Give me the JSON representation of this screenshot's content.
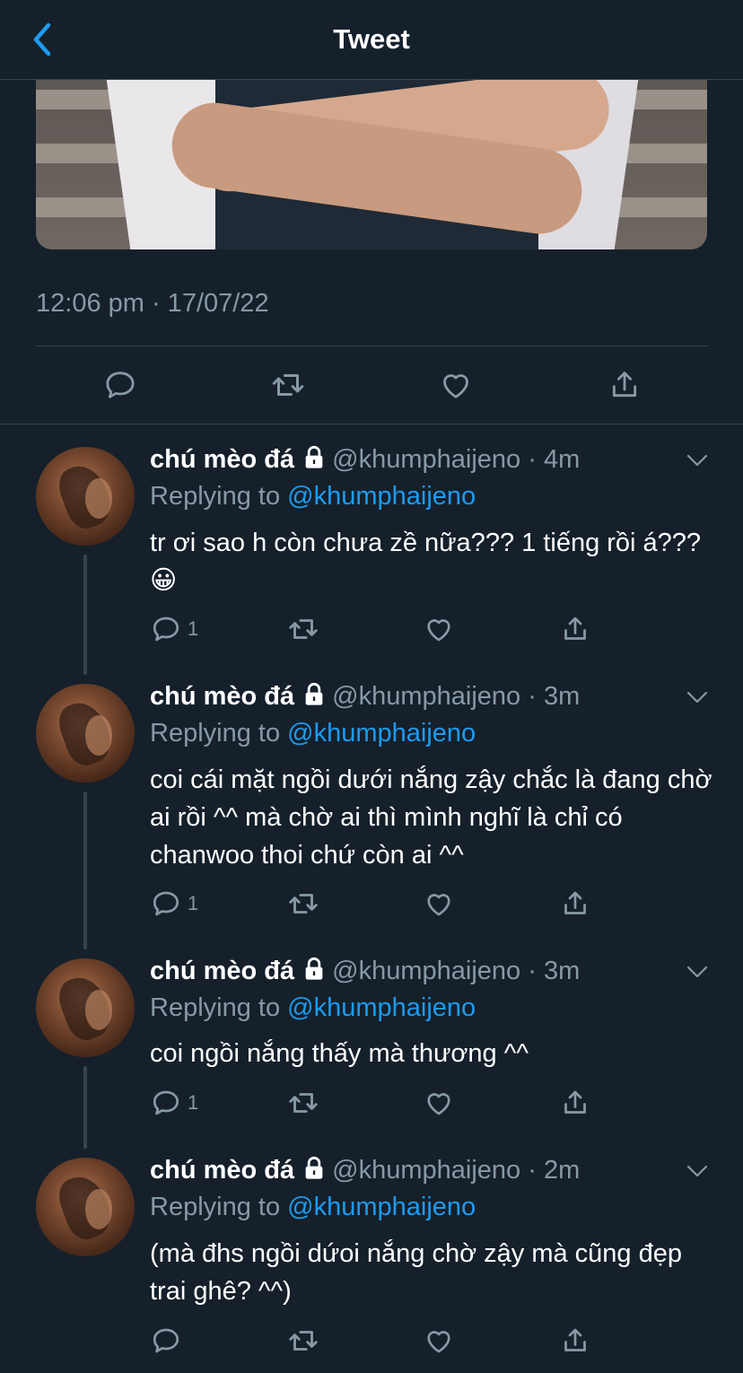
{
  "header": {
    "title": "Tweet"
  },
  "tweet": {
    "timestamp": "12:06 pm · 17/07/22"
  },
  "replies": [
    {
      "name": "chú mèo đá",
      "handle": "@khumphaijeno",
      "time": "4m",
      "replying_prefix": "Replying to",
      "replying_to": "@khumphaijeno",
      "text": "tr ơi sao h còn chưa zề nữa??? 1 tiếng rồi á??? 😀",
      "reply_count": "1"
    },
    {
      "name": "chú mèo đá",
      "handle": "@khumphaijeno",
      "time": "3m",
      "replying_prefix": "Replying to",
      "replying_to": "@khumphaijeno",
      "text": "coi cái mặt ngồi dưới nắng zậy chắc là đang chờ ai rồi ^^ mà chờ ai thì mình nghĩ là chỉ có chanwoo thoi chứ còn ai ^^",
      "reply_count": "1"
    },
    {
      "name": "chú mèo đá",
      "handle": "@khumphaijeno",
      "time": "3m",
      "replying_prefix": "Replying to",
      "replying_to": "@khumphaijeno",
      "text": "coi ngồi nắng thấy mà thương ^^",
      "reply_count": "1"
    },
    {
      "name": "chú mèo đá",
      "handle": "@khumphaijeno",
      "time": "2m",
      "replying_prefix": "Replying to",
      "replying_to": "@khumphaijeno",
      "text": "(mà đhs ngồi dứoi nắng chờ zậy mà cũng đẹp trai ghê? ^^)",
      "reply_count": ""
    }
  ],
  "colors": {
    "background": "#15202b",
    "accent": "#1d9bf0",
    "secondary_text": "#8899a6",
    "divider": "#38444d"
  },
  "icons": [
    "back-chevron-icon",
    "reply-icon",
    "retweet-icon",
    "like-icon",
    "share-icon",
    "lock-icon",
    "chevron-down-icon"
  ]
}
